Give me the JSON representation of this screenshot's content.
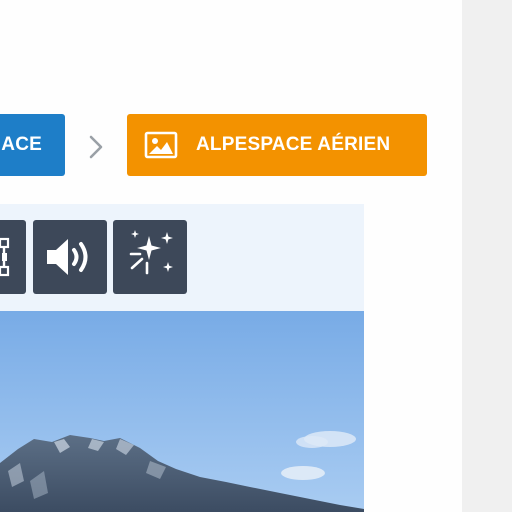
{
  "breadcrumb": {
    "previous_label": "ACE",
    "current_label": "ALPESPACE AÉRIEN",
    "current_icon": "image-icon",
    "separator_icon": "chevron-right-icon"
  },
  "toolbar": {
    "buttons": [
      {
        "icon": "fit-frame-icon"
      },
      {
        "icon": "volume-icon"
      },
      {
        "icon": "magic-sparkle-icon"
      }
    ]
  },
  "photo": {
    "subject": "alpine-mountain-sky"
  },
  "colors": {
    "previous_crumb": "#1e7ec8",
    "current_crumb": "#f39200",
    "tool_button": "#3d4859",
    "toolbar_bg": "#edf4fc",
    "sky": "#7fb1e8"
  }
}
